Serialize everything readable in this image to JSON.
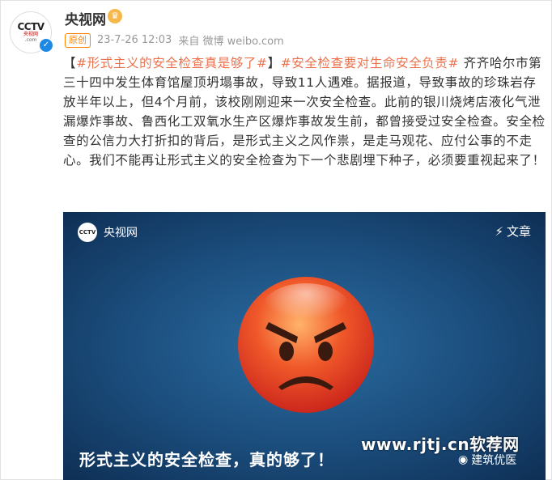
{
  "author": {
    "name": "央视网",
    "logo_text": "CCTV",
    "logo_sub": "央视网",
    "logo_com": ".com"
  },
  "meta": {
    "badge": "原创",
    "time": "23-7-26 12:03",
    "source": "来自 微博 weibo.com"
  },
  "post": {
    "bracket_open": "【",
    "topic1": "#形式主义的安全检查真是够了#",
    "bracket_close": "】",
    "topic2": "#安全检查要对生命安全负责#",
    "body": " 齐齐哈尔市第三十四中发生体育馆屋顶坍塌事故，导致11人遇难。据报道，导致事故的珍珠岩存放半年以上，但4个月前，该校刚刚迎来一次安全检查。此前的银川烧烤店液化气泄漏爆炸事故、鲁西化工双氧水生产区爆炸事故发生前，都曾接受过安全检查。安全检查的公信力大打折扣的背后，是形式主义之风作祟，是走马观花、应付公事的不走心。我们不能再让形式主义的安全检查为下一个悲剧埋下种子，必须要重视起来了！"
  },
  "card": {
    "account": "央视网",
    "type": "文章",
    "title": "形式主义的安全检查，真的够了！",
    "emoji_icon": "angry-face-icon"
  },
  "watermark": {
    "url": "www.rjtj.cn软荐网",
    "brand": "建筑优医"
  },
  "colors": {
    "topic": "#eb7350",
    "badge": "#ff8200",
    "card_bg": "#1c4f7f"
  }
}
